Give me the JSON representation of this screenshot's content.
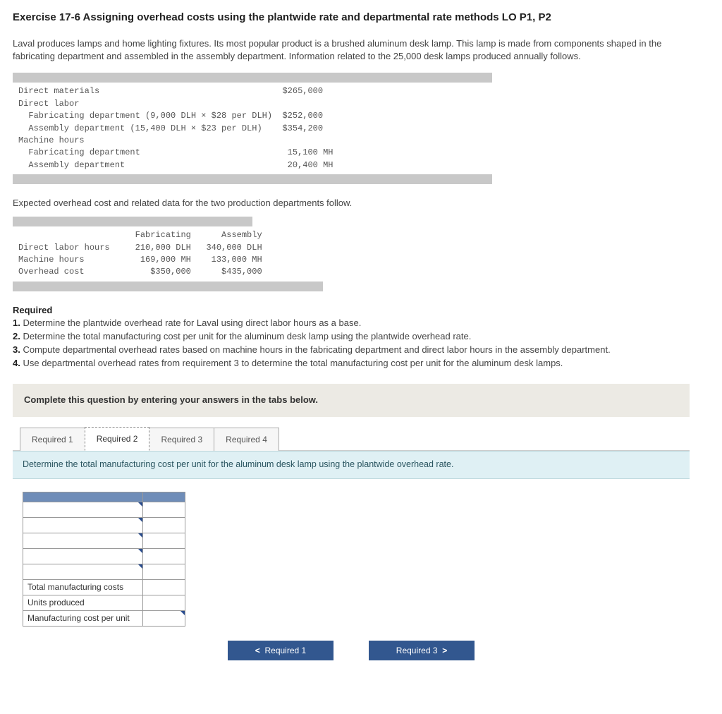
{
  "title": "Exercise 17-6 Assigning overhead costs using the plantwide rate and departmental rate methods LO P1, P2",
  "intro": "Laval produces lamps and home lighting fixtures. Its most popular product is a brushed aluminum desk lamp. This lamp is made from components shaped in the fabricating department and assembled in the assembly department. Information related to the 25,000 desk lamps produced annually follows.",
  "block1": {
    "rows": [
      {
        "label": "Direct materials",
        "value": "$265,000"
      },
      {
        "label": "Direct labor",
        "value": ""
      },
      {
        "label": "  Fabricating department (9,000 DLH × $28 per DLH)",
        "value": "$252,000"
      },
      {
        "label": "  Assembly department (15,400 DLH × $23 per DLH)",
        "value": "$354,200"
      },
      {
        "label": "Machine hours",
        "value": ""
      },
      {
        "label": "  Fabricating department",
        "value": " 15,100 MH"
      },
      {
        "label": "  Assembly department",
        "value": " 20,400 MH"
      }
    ]
  },
  "sect2": "Expected overhead cost and related data for the two production departments follow.",
  "block2": {
    "col1": "Fabricating",
    "col2": "Assembly",
    "rows": [
      {
        "label": "Direct labor hours",
        "c1": "210,000 DLH",
        "c2": "340,000 DLH"
      },
      {
        "label": "Machine hours",
        "c1": "169,000 MH",
        "c2": "133,000 MH"
      },
      {
        "label": "Overhead cost",
        "c1": "$350,000",
        "c2": "$435,000"
      }
    ]
  },
  "required_hdr": "Required",
  "required": [
    "Determine the plantwide overhead rate for Laval using direct labor hours as a base.",
    "Determine the total manufacturing cost per unit for the aluminum desk lamp using the plantwide overhead rate.",
    "Compute departmental overhead rates based on machine hours in the fabricating department and direct labor hours in the assembly department.",
    "Use departmental overhead rates from requirement 3 to determine the total manufacturing cost per unit for the aluminum desk lamps."
  ],
  "answer_instr": "Complete this question by entering your answers in the tabs below.",
  "tabs": [
    {
      "label": "Required 1"
    },
    {
      "label": "Required 2"
    },
    {
      "label": "Required 3"
    },
    {
      "label": "Required 4"
    }
  ],
  "active_tab_index": 1,
  "tab_prompt": "Determine the total manufacturing cost per unit for the aluminum desk lamp using the plantwide overhead rate.",
  "entry_rows": {
    "r0": "Total manufacturing costs",
    "r1": "Units produced",
    "r2": "Manufacturing cost per unit"
  },
  "nav": {
    "prev": "Required 1",
    "next": "Required 3"
  }
}
